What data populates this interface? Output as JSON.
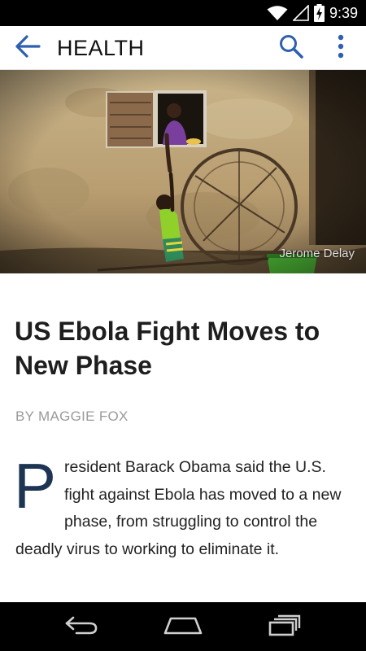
{
  "status_bar": {
    "time": "9:39",
    "icons": [
      "wifi-icon",
      "signal-icon",
      "battery-charging-icon"
    ]
  },
  "app_bar": {
    "back_icon": "arrow-back-icon",
    "title": "HEALTH",
    "search_icon": "search-icon",
    "more_icon": "more-vertical-icon",
    "accent_color": "#2f5fb0"
  },
  "hero": {
    "photo_credit": "Jerome Delay"
  },
  "article": {
    "headline": "US Ebola Fight Moves to New Phase",
    "byline": "BY MAGGIE FOX",
    "dropcap": "P",
    "body_rest": "resident Barack Obama said the U.S. fight against Ebola has moved to a new phase, from struggling to control the deadly virus to working to eliminate it.",
    "dropcap_color": "#1d3553"
  },
  "nav_bar": {
    "back_icon": "nav-back-icon",
    "home_icon": "nav-home-icon",
    "recents_icon": "nav-recents-icon"
  }
}
